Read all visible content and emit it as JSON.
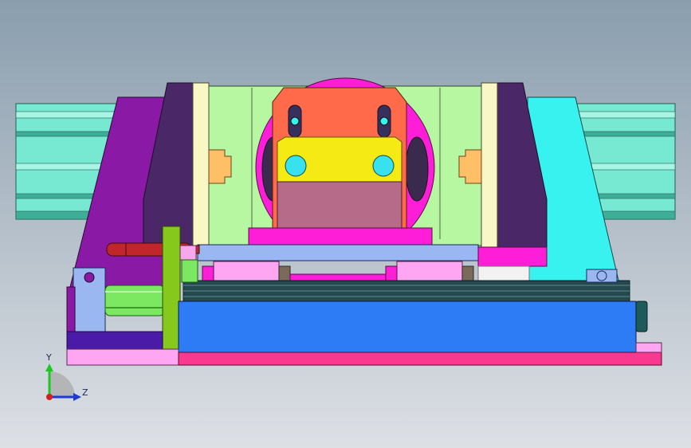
{
  "view": {
    "axes": {
      "y_label": "Y",
      "z_label": "Z"
    },
    "colors": {
      "rail": "#77e9d2",
      "rail_dark": "#3fae98",
      "purple": "#8a1aa5",
      "dark_purple": "#4a2766",
      "cyan": "#37f2ee",
      "pale_green": "#b7f7a1",
      "cream": "#f9f7c6",
      "orange": "#ff6b4a",
      "yellow": "#f5ea14",
      "mauve": "#b66c88",
      "magenta": "#ff1ed8",
      "pink": "#ffa6f2",
      "blue": "#2e7cf5",
      "light_blue": "#9ab7f2",
      "hot_pink": "#f9388f",
      "lime": "#86c81b",
      "cylinder_green": "#7ce862",
      "red": "#c0262b",
      "tan": "#ffbf66"
    }
  }
}
